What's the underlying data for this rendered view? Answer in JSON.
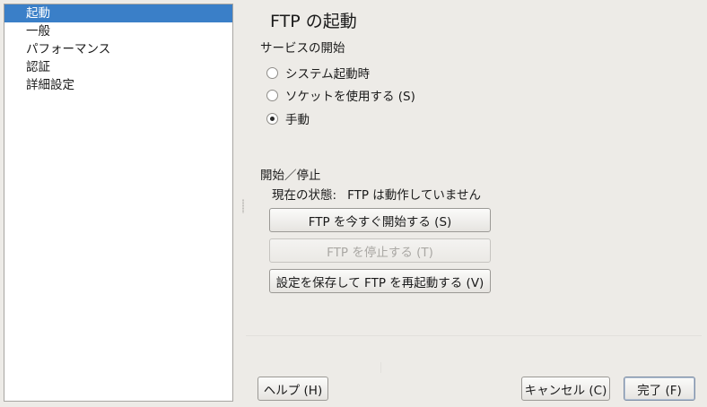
{
  "sidebar": {
    "items": [
      {
        "label": "起動",
        "selected": true
      },
      {
        "label": "一般",
        "selected": false
      },
      {
        "label": "パフォーマンス",
        "selected": false
      },
      {
        "label": "認証",
        "selected": false
      },
      {
        "label": "詳細設定",
        "selected": false
      }
    ]
  },
  "main": {
    "title": "FTP の起動",
    "service_start": {
      "heading": "サービスの開始",
      "options": [
        {
          "label": "システム起動時",
          "checked": false
        },
        {
          "label": "ソケットを使用する (S)",
          "checked": false
        },
        {
          "label": "手動",
          "checked": true
        }
      ]
    },
    "start_stop": {
      "heading": "開始／停止",
      "status_label": "現在の状態:",
      "status_value": "FTP は動作していません",
      "start_now_button": "FTP を今すぐ開始する (S)",
      "stop_button": "FTP を停止する (T)",
      "save_restart_button": "設定を保存して FTP を再起動する (V)"
    }
  },
  "footer": {
    "help_button": "ヘルプ (H)",
    "cancel_button": "キャンセル (C)",
    "finish_button": "完了 (F)"
  }
}
